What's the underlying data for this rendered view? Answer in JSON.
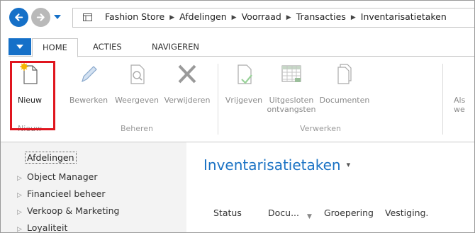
{
  "breadcrumb": {
    "items": [
      "Fashion Store",
      "Afdelingen",
      "Voorraad",
      "Transacties",
      "Inventarisatietaken"
    ]
  },
  "ribbon": {
    "tabs": [
      "HOME",
      "ACTIES",
      "NAVIGEREN"
    ],
    "active_tab": "HOME",
    "buttons": {
      "nieuw": "Nieuw",
      "bewerken": "Bewerken",
      "weergeven": "Weergeven",
      "verwijderen": "Verwijderen",
      "vrijgeven": "Vrijgeven",
      "uitgesloten_line1": "Uitgesloten",
      "uitgesloten_line2": "ontvangsten",
      "documenten": "Documenten",
      "als_line1": "Als",
      "als_line2": "we"
    },
    "groups": {
      "nieuw": "Nieuw",
      "beheren": "Beheren",
      "verwerken": "Verwerken"
    }
  },
  "nav": {
    "selected": "Afdelingen",
    "items": [
      "Object Manager",
      "Financieel beheer",
      "Verkoop & Marketing",
      "Loyaliteit"
    ]
  },
  "content": {
    "title": "Inventarisatietaken",
    "columns": [
      "Status",
      "Docu...",
      "Groepering",
      "Vestiging."
    ]
  },
  "colors": {
    "accent": "#1570c8",
    "title": "#1a72c4",
    "highlight": "#e0151e"
  },
  "icons": [
    "back-arrow-icon",
    "forward-arrow-icon",
    "history-dropdown-icon",
    "page-icon",
    "new-document-icon",
    "pencil-icon",
    "magnifier-document-icon",
    "delete-x-icon",
    "release-document-icon",
    "grid-table-icon",
    "documents-icon"
  ]
}
